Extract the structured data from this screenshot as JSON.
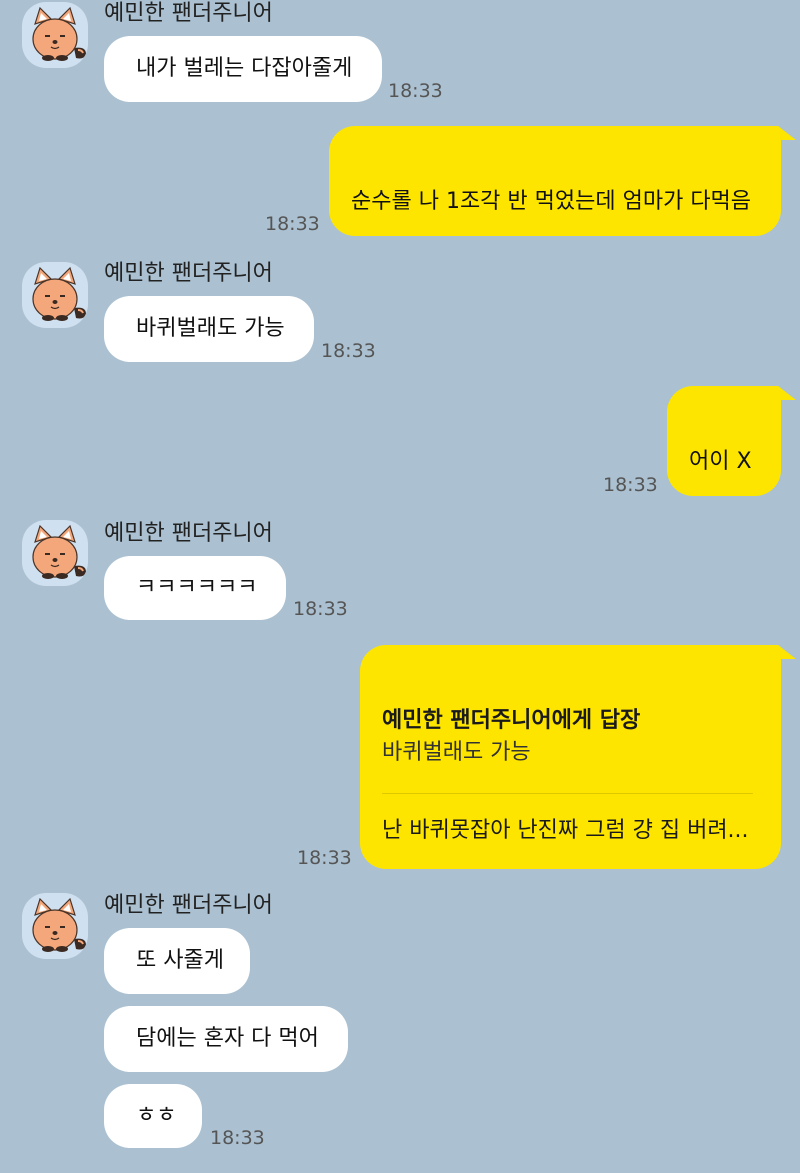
{
  "colors": {
    "background": "#abc1d1",
    "my_bubble": "#fde500",
    "their_bubble": "#ffffff",
    "avatar_bg": "#cfe0f0"
  },
  "contact": {
    "name": "예민한 팬더주니어",
    "avatar_icon": "red-panda-character-icon"
  },
  "messages": [
    {
      "id": "m1",
      "from": "them",
      "sender": "예민한 팬더주니어",
      "text": "내가 벌레는 다잡아줄게",
      "time": "18:33"
    },
    {
      "id": "m2",
      "from": "me",
      "text": "순수롤 나 1조각 반 먹었는데 엄마가 다먹음",
      "time": "18:33"
    },
    {
      "id": "m3",
      "from": "them",
      "sender": "예민한 팬더주니어",
      "text": "바퀴벌래도 가능",
      "time": "18:33"
    },
    {
      "id": "m4",
      "from": "me",
      "text": "어이 X",
      "time": "18:33"
    },
    {
      "id": "m5",
      "from": "them",
      "sender": "예민한 팬더주니어",
      "text": "ㅋㅋㅋㅋㅋㅋ",
      "time": "18:33"
    },
    {
      "id": "m6",
      "from": "me",
      "reply_to": {
        "title": "예민한 팬더주니어에게 답장",
        "quoted_text": "바퀴벌래도 가능"
      },
      "text": "난 바퀴못잡아 난진짜 그럼 걍 집 버려...",
      "time": "18:33"
    },
    {
      "id": "m7",
      "from": "them",
      "sender": "예민한 팬더주니어",
      "text": "또 사줄게"
    },
    {
      "id": "m8",
      "from": "them",
      "text": "담에는 혼자 다 먹어"
    },
    {
      "id": "m9",
      "from": "them",
      "text": "ㅎㅎ",
      "time": "18:33"
    }
  ]
}
